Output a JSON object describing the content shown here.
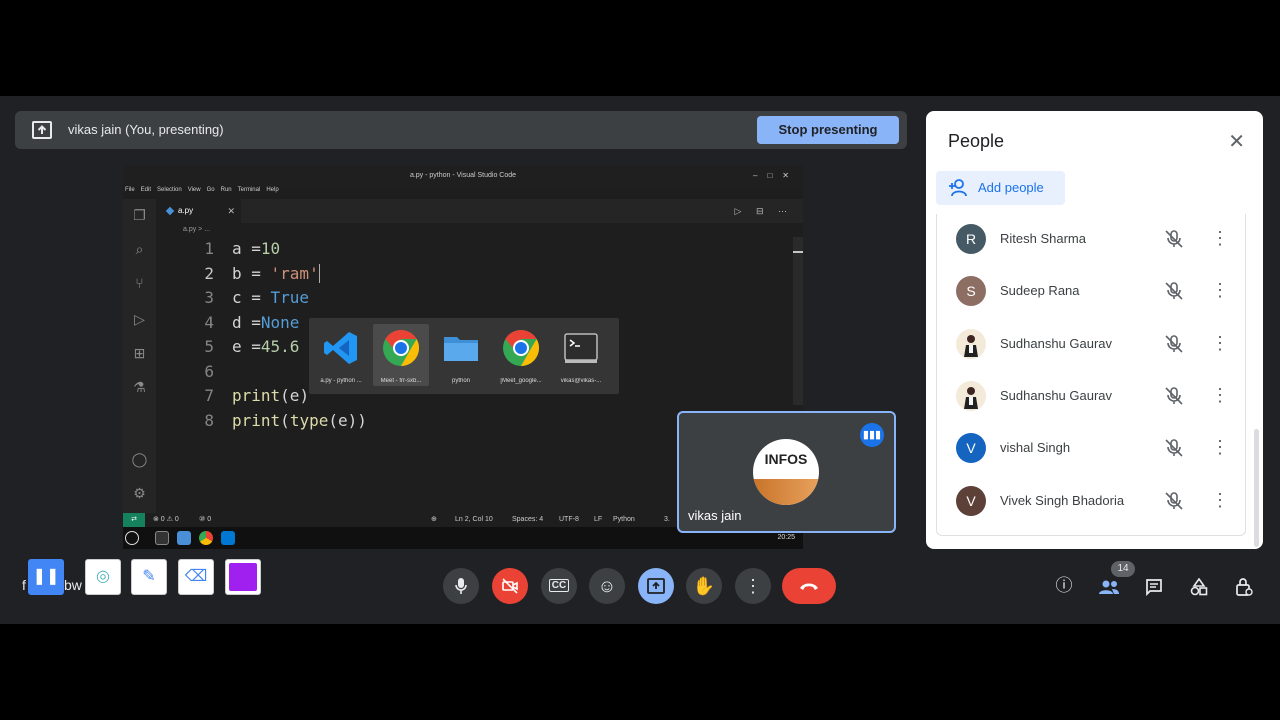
{
  "presenting": {
    "label": "vikas jain (You, presenting)",
    "stop_label": "Stop presenting"
  },
  "editor": {
    "window_title": "a.py - python - Visual Studio Code",
    "menu": [
      "File",
      "Edit",
      "Selection",
      "View",
      "Go",
      "Run",
      "Terminal",
      "Help"
    ],
    "tab_label": "a.py",
    "breadcrumb": "a.py > ...",
    "lines": [
      {
        "num": "1",
        "text": "a =10"
      },
      {
        "num": "2",
        "text": "b = 'ram'"
      },
      {
        "num": "3",
        "text": "c = True"
      },
      {
        "num": "4",
        "text": "d =None"
      },
      {
        "num": "5",
        "text": "e =45.6"
      },
      {
        "num": "6",
        "text": ""
      },
      {
        "num": "7",
        "text": "print(e)"
      },
      {
        "num": "8",
        "text": "print(type(e))"
      }
    ],
    "status": {
      "problems": "⊗ 0 ⚠ 0",
      "ports": "⑩ 0",
      "position": "Ln 2, Col 10",
      "spaces": "Spaces: 4",
      "encoding": "UTF-8",
      "eol": "LF",
      "language": "Python",
      "version": "3."
    },
    "taskbar_time": "20:25"
  },
  "switcher": {
    "items": [
      {
        "label": "a.py - python ...",
        "icon": "vscode-icon"
      },
      {
        "label": "Meet - frr-sxb...",
        "icon": "chrome-icon"
      },
      {
        "label": "python",
        "icon": "folder-icon"
      },
      {
        "label": "[Meet_google...",
        "icon": "chrome-icon"
      },
      {
        "label": "vikas@vikas-...",
        "icon": "terminal-icon"
      }
    ]
  },
  "self_tile": {
    "name": "vikas jain",
    "avatar_text": "INFOS"
  },
  "meeting": {
    "code_partial_1": "f",
    "code_partial_2": "bw"
  },
  "participants_count": "14",
  "people_panel": {
    "title": "People",
    "add_label": "Add people",
    "people": [
      {
        "name": "Ritesh Sharma",
        "initial": "R",
        "color": "#455a64"
      },
      {
        "name": "Sudeep Rana",
        "initial": "S",
        "color": "#8d6e63"
      },
      {
        "name": "Sudhanshu Gaurav",
        "initial": "",
        "color": "#e0c9a6"
      },
      {
        "name": "Sudhanshu Gaurav",
        "initial": "",
        "color": "#e0c9a6"
      },
      {
        "name": "vishal Singh",
        "initial": "V",
        "color": "#1565c0"
      },
      {
        "name": "Vivek Singh Bhadoria",
        "initial": "V",
        "color": "#5d4037"
      }
    ]
  },
  "colors": {
    "accent": "#8ab4f8",
    "danger": "#ea4335",
    "background": "#202124"
  }
}
